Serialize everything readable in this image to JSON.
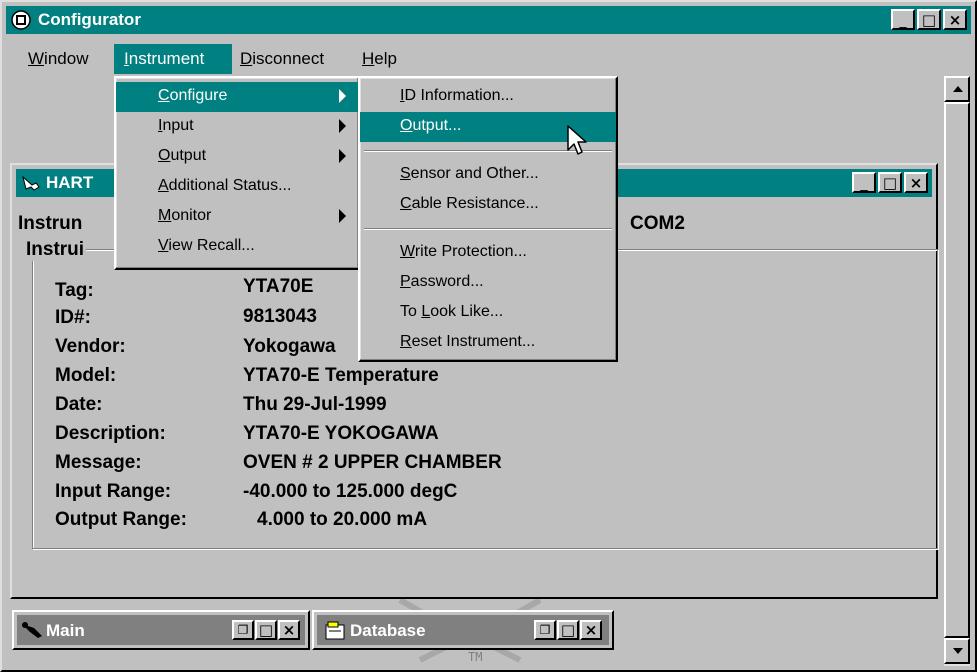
{
  "app": {
    "title": "Configurator",
    "controls": [
      "_",
      "□",
      "×"
    ]
  },
  "menubar": {
    "items": [
      {
        "key": "W",
        "rest": "indow"
      },
      {
        "key": "I",
        "rest": "nstrument"
      },
      {
        "key": "D",
        "rest": "isconnect"
      },
      {
        "key": "H",
        "rest": "elp"
      }
    ]
  },
  "instrument_menu": {
    "items": [
      {
        "pre": "",
        "key": "C",
        "rest": "onfigure"
      },
      {
        "pre": "",
        "key": "I",
        "rest": "nput"
      },
      {
        "pre": "",
        "key": "O",
        "rest": "utput"
      },
      {
        "pre": "",
        "key": "A",
        "rest": "dditional Status..."
      },
      {
        "pre": "",
        "key": "M",
        "rest": "onitor"
      },
      {
        "pre": "",
        "key": "V",
        "rest": "iew Recall..."
      }
    ]
  },
  "configure_submenu": {
    "items": [
      {
        "pre": "",
        "key": "I",
        "rest": "D Information..."
      },
      {
        "pre": "",
        "key": "O",
        "rest": "utput..."
      },
      {
        "pre": "",
        "key": "S",
        "rest": "ensor and Other..."
      },
      {
        "pre": "",
        "key": "C",
        "rest": "able Resistance..."
      },
      {
        "pre": "",
        "key": "W",
        "rest": "rite Protection..."
      },
      {
        "pre": "",
        "key": "P",
        "rest": "assword..."
      },
      {
        "pre": "To ",
        "key": "L",
        "rest": "ook Like..."
      },
      {
        "pre": "",
        "key": "R",
        "rest": "eset Instrument..."
      }
    ]
  },
  "hart_window": {
    "title": "HART",
    "header_left": "Instrun",
    "header_right": "COM2",
    "group_label": "Instrui",
    "fields": [
      {
        "label": "Tag:",
        "value": "YTA70E"
      },
      {
        "label": "ID#:",
        "value": "9813043"
      },
      {
        "label": "Vendor:",
        "value": "Yokogawa"
      },
      {
        "label": "Model:",
        "value": "YTA70-E Temperature"
      },
      {
        "label": "Date:",
        "value": "Thu 29-Jul-1999"
      },
      {
        "label": "Description:",
        "value": "YTA70-E YOKOGAWA"
      },
      {
        "label": "Message:",
        "value": "OVEN # 2 UPPER CHAMBER"
      },
      {
        "label": "Input Range:",
        "value": "-40.000 to 125.000 degC"
      },
      {
        "label": "Output Range:",
        "value": "4.000 to 20.000 mA"
      }
    ]
  },
  "minimized": {
    "main": "Main",
    "database": "Database"
  },
  "background_text": "TM",
  "colors": {
    "title_bg": "#008080",
    "face": "#c0c0c0"
  }
}
